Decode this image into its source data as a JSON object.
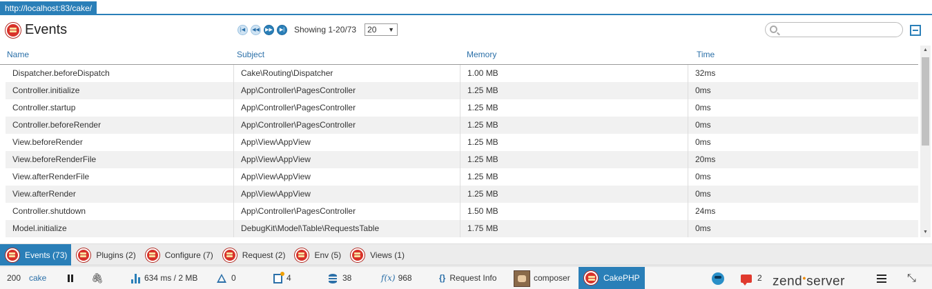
{
  "url_tab": "http://localhost:83/cake/",
  "header": {
    "title": "Events",
    "logo_icon": "cakephp-logo-icon",
    "pager": {
      "showing": "Showing 1-20/73",
      "per_page": "20"
    },
    "search": {
      "placeholder": ""
    },
    "collapse_icon": "collapse-icon"
  },
  "table": {
    "columns": [
      "Name",
      "Subject",
      "Memory",
      "Time"
    ],
    "rows": [
      [
        "Dispatcher.beforeDispatch",
        "Cake\\Routing\\Dispatcher",
        "1.00 MB",
        "32ms"
      ],
      [
        "Controller.initialize",
        "App\\Controller\\PagesController",
        "1.25 MB",
        "0ms"
      ],
      [
        "Controller.startup",
        "App\\Controller\\PagesController",
        "1.25 MB",
        "0ms"
      ],
      [
        "Controller.beforeRender",
        "App\\Controller\\PagesController",
        "1.25 MB",
        "0ms"
      ],
      [
        "View.beforeRender",
        "App\\View\\AppView",
        "1.25 MB",
        "0ms"
      ],
      [
        "View.beforeRenderFile",
        "App\\View\\AppView",
        "1.25 MB",
        "20ms"
      ],
      [
        "View.afterRenderFile",
        "App\\View\\AppView",
        "1.25 MB",
        "0ms"
      ],
      [
        "View.afterRender",
        "App\\View\\AppView",
        "1.25 MB",
        "0ms"
      ],
      [
        "Controller.shutdown",
        "App\\Controller\\PagesController",
        "1.50 MB",
        "24ms"
      ],
      [
        "Model.initialize",
        "DebugKit\\Model\\Table\\RequestsTable",
        "1.75 MB",
        "0ms"
      ]
    ]
  },
  "tabs": [
    {
      "label": "Events (73)",
      "active": true
    },
    {
      "label": "Plugins (2)",
      "active": false
    },
    {
      "label": "Configure (7)",
      "active": false
    },
    {
      "label": "Request (2)",
      "active": false
    },
    {
      "label": "Env (5)",
      "active": false
    },
    {
      "label": "Views (1)",
      "active": false
    }
  ],
  "statusbar": {
    "status_code": "200",
    "app_name": "cake",
    "time_memory": "634 ms / 2 MB",
    "warnings": "0",
    "notes": "4",
    "queries": "38",
    "functions_label": "f(x)",
    "functions": "968",
    "request_info": "Request Info",
    "composer": "composer",
    "cakephp": "CakePHP",
    "messages": "2",
    "zend_brand": "zend",
    "zend_brand_suffix": "server"
  },
  "colors": {
    "accent": "#2a7fb8",
    "cake_red": "#d8322a",
    "alt_row": "#f1f1f1"
  }
}
